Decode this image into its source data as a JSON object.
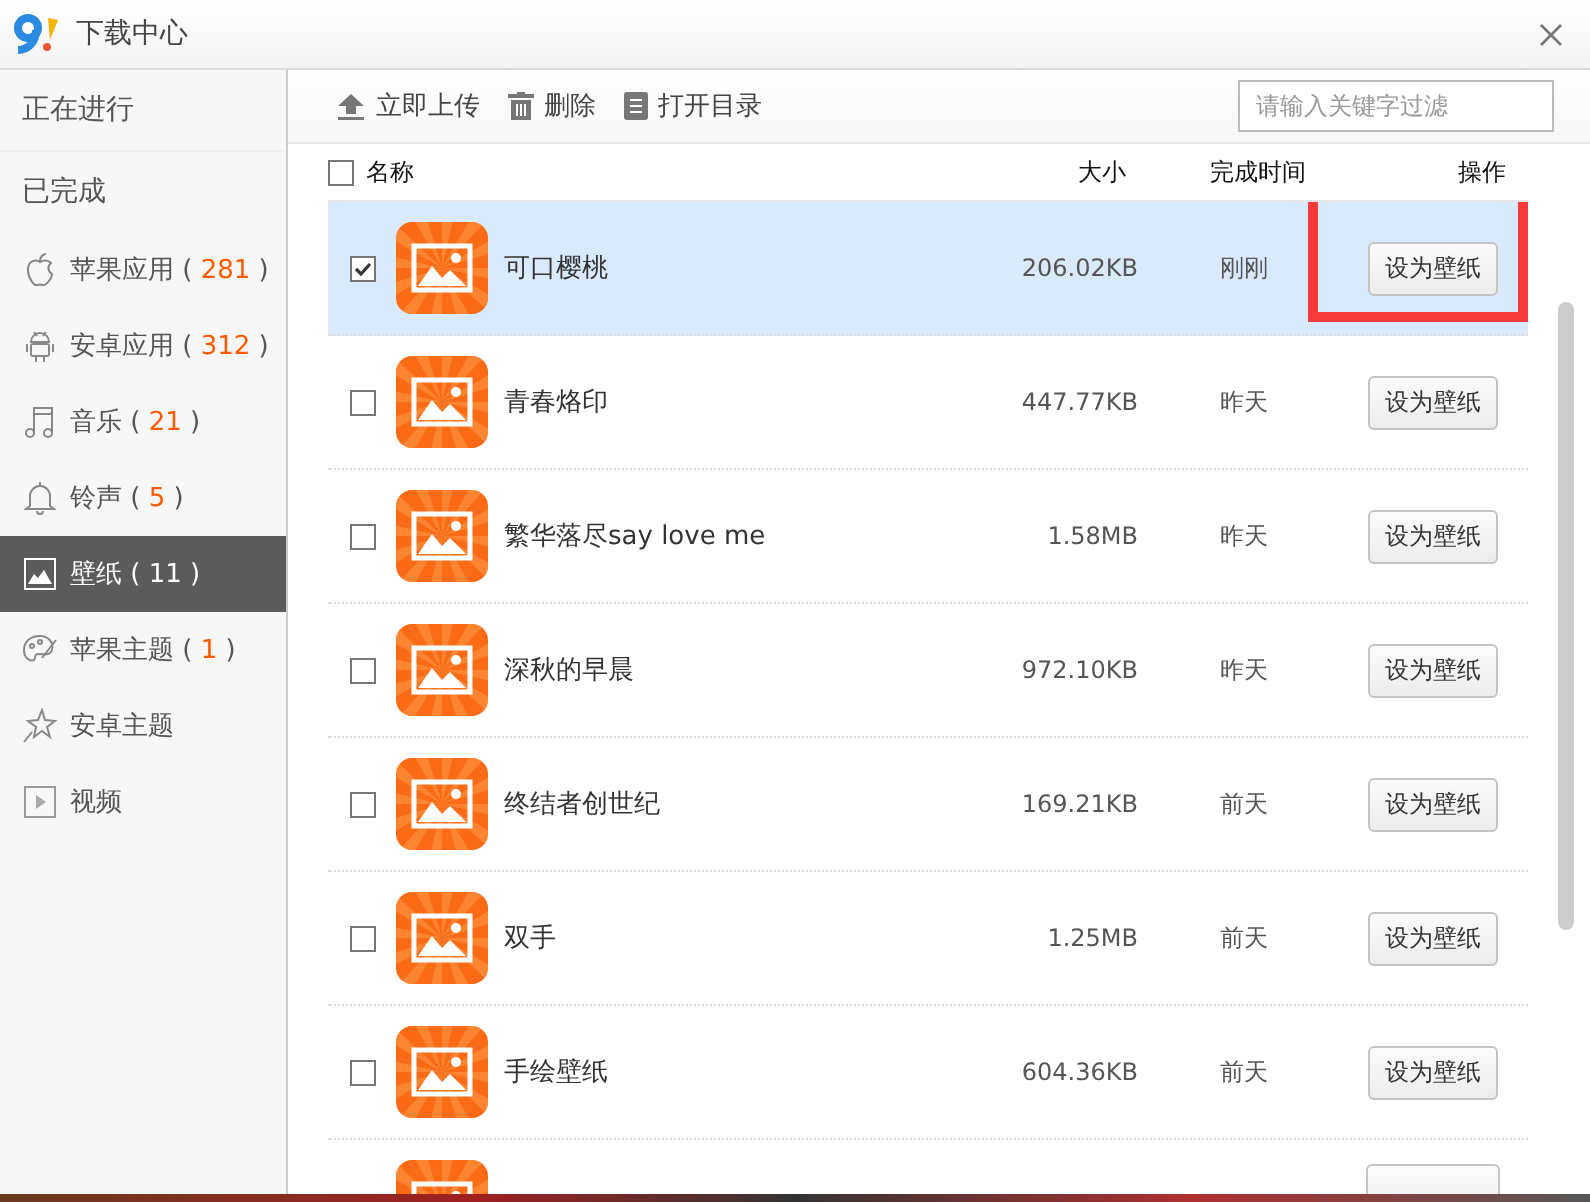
{
  "window": {
    "title": "下载中心"
  },
  "sidebar": {
    "sections": [
      {
        "label": "正在进行"
      },
      {
        "label": "已完成"
      }
    ],
    "items": [
      {
        "label": "苹果应用",
        "paren_open": "(",
        "count": "281",
        "paren_close": ")",
        "selected": false
      },
      {
        "label": "安卓应用",
        "paren_open": "(",
        "count": "312",
        "paren_close": ")",
        "selected": false
      },
      {
        "label": "音乐",
        "paren_open": "(",
        "count": "21",
        "paren_close": ")",
        "selected": false
      },
      {
        "label": "铃声",
        "paren_open": "(",
        "count": "5",
        "paren_close": ")",
        "selected": false
      },
      {
        "label": "壁纸",
        "paren_open": "(",
        "count": "11",
        "paren_close": ")",
        "selected": true
      },
      {
        "label": "苹果主题",
        "paren_open": "(",
        "count": "1",
        "paren_close": ")",
        "selected": false
      },
      {
        "label": "安卓主题",
        "selected": false
      },
      {
        "label": "视频",
        "selected": false
      }
    ]
  },
  "toolbar": {
    "buttons": [
      {
        "label": "立即上传"
      },
      {
        "label": "删除"
      },
      {
        "label": "打开目录"
      }
    ],
    "search": {
      "placeholder": "请输入关键字过滤"
    }
  },
  "table": {
    "select_all": {
      "checked": false
    },
    "columns": [
      "名称",
      "大小",
      "完成时间",
      "操作"
    ],
    "rows": [
      {
        "kind": "full",
        "name": "可口樱桃",
        "size": "206.02KB",
        "time": "刚刚",
        "action": "设为壁纸",
        "checked": true,
        "selected": true,
        "highlighted": true
      },
      {
        "kind": "full",
        "name": "青春烙印",
        "size": "447.77KB",
        "time": "昨天",
        "action": "设为壁纸",
        "checked": false,
        "selected": false,
        "highlighted": false
      },
      {
        "kind": "full",
        "name": "繁华落尽say love me",
        "size": "1.58MB",
        "time": "昨天",
        "action": "设为壁纸",
        "checked": false,
        "selected": false,
        "highlighted": false
      },
      {
        "kind": "full",
        "name": "深秋的早晨",
        "size": "972.10KB",
        "time": "昨天",
        "action": "设为壁纸",
        "checked": false,
        "selected": false,
        "highlighted": false
      },
      {
        "kind": "full",
        "name": "终结者创世纪",
        "size": "169.21KB",
        "time": "前天",
        "action": "设为壁纸",
        "checked": false,
        "selected": false,
        "highlighted": false
      },
      {
        "kind": "full",
        "name": "双手",
        "size": "1.25MB",
        "time": "前天",
        "action": "设为壁纸",
        "checked": false,
        "selected": false,
        "highlighted": false
      },
      {
        "kind": "full",
        "name": "手绘壁纸",
        "size": "604.36KB",
        "time": "前天",
        "action": "设为壁纸",
        "checked": false,
        "selected": false,
        "highlighted": false
      },
      {
        "kind": "cut-off"
      }
    ]
  }
}
